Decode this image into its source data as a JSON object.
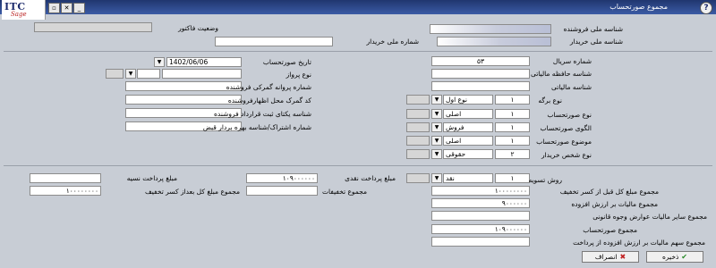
{
  "window": {
    "title": "مجموع صورتحساب",
    "logo_text": "ITC",
    "logo_sub": "Sage",
    "controls": {
      "minimize": "_",
      "restore": "▫",
      "close": "✕",
      "help": "?"
    }
  },
  "seller": {
    "seller_national_id_label": "شناسه ملی فروشنده",
    "buyer_national_id_label": "شناسه ملی خریدار",
    "buyer_national_id2_label": "شماره ملی خریدار",
    "invoice_status_label": "وضعیت فاکتور"
  },
  "form": {
    "serial_label": "شماره سریال",
    "serial_value": "۵۳",
    "tax_memory_label": "شناسه حافظه مالیاتی",
    "tax_id_label": "شناسه مالیاتی",
    "sheet_type_label": "نوع برگه",
    "sheet_type_code": "۱",
    "sheet_type_value": "نوع اول",
    "invoice_type_label": "نوع صورتحساب",
    "invoice_type_code": "۱",
    "invoice_type_value": "اصلی",
    "pattern_label": "الگوی صورتحساب",
    "pattern_code": "۱",
    "pattern_value": "فروش",
    "subject_label": "موضوع صورتحساب",
    "subject_code": "۱",
    "subject_value": "اصلی",
    "buyer_type_label": "نوع شخص خریدار",
    "buyer_type_code": "۲",
    "buyer_type_value": "حقوقی",
    "date_label": "تاریخ صورتحساب",
    "date_value": "1402/06/06",
    "flight_type_label": "نوع پرواز",
    "customs_license_label": "شماره پروانه گمرکی فروشنده",
    "customs_code_label": "کد گمرک محل اظهارفروشنده",
    "contract_id_label": "شناسه یکتای ثبت قرارداد فروشنده",
    "subscription_label": "شماره اشتراک/شناسه بهره بردار قبض"
  },
  "payment": {
    "method_label": "روش تسویه",
    "method_code": "۱",
    "method_value": "نقد",
    "cash_label": "مبلغ پرداخت نقدی",
    "cash_value": "۱۰۹۰۰۰۰۰۰",
    "credit_label": "مبلغ پرداخت نسیه",
    "total_before_discount_label": "مجموع مبلغ کل قبل از کسر تخفیف",
    "total_before_discount_value": "۱۰۰۰۰۰۰۰۰",
    "discounts_label": "مجموع تخفیفات",
    "total_after_discount_label": "مجموع مبلغ کل بعداز کسر تخفیف",
    "total_after_discount_value": "۱۰۰۰۰۰۰۰۰",
    "vat_label": "مجموع مالیات بر ارزش افزوده",
    "vat_value": "۹۰۰۰۰۰۰",
    "other_duties_label": "مجموع سایر مالیات عوارض وجوه قانونی",
    "invoice_total_label": "مجموع صورتحساب",
    "invoice_total_value": "۱۰۹۰۰۰۰۰۰",
    "vat_share_label": "مجموع سهم مالیات بر ارزش افزوده از پرداخت"
  },
  "buttons": {
    "save": "ذخیره",
    "cancel": "انصراف"
  }
}
